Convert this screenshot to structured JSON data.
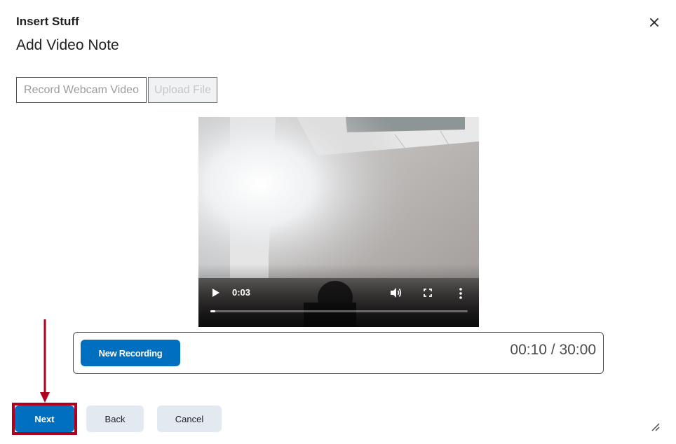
{
  "dialog": {
    "title": "Insert Stuff",
    "heading": "Add Video Note"
  },
  "tabs": [
    {
      "label": "Record Webcam Video",
      "state": "enabled"
    },
    {
      "label": "Upload File",
      "state": "disabled"
    }
  ],
  "video": {
    "current_time": "0:03",
    "progress_fraction": 0.02
  },
  "recorder": {
    "new_recording_label": "New Recording",
    "timer": "00:10 / 30:00"
  },
  "footer": {
    "next_label": "Next",
    "back_label": "Back",
    "cancel_label": "Cancel"
  },
  "colors": {
    "primary": "#006fbf",
    "secondary_button": "#e3e9f1",
    "highlight": "#b00020"
  },
  "icons": [
    "close-icon",
    "play-icon",
    "volume-icon",
    "fullscreen-icon",
    "more-options-icon",
    "resize-handle-icon",
    "annotation-arrow"
  ]
}
